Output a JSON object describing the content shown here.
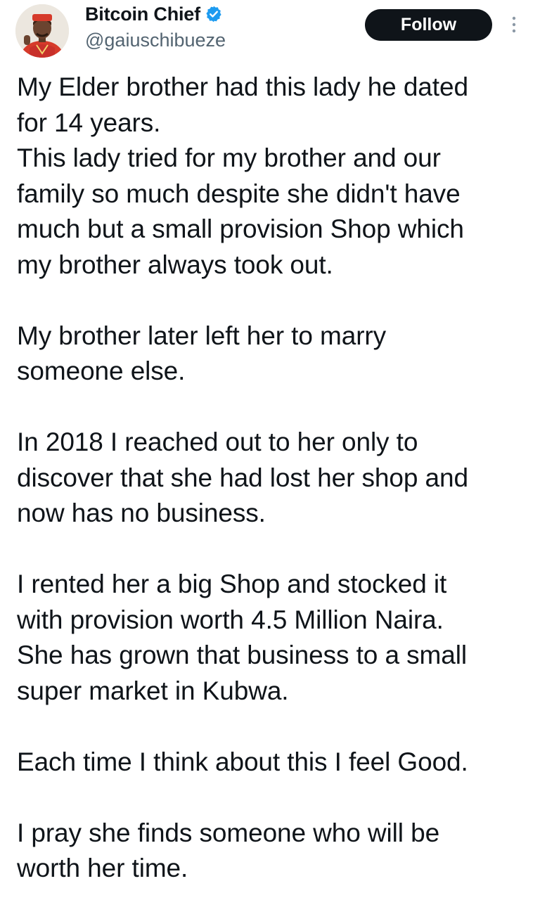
{
  "author": {
    "display_name": "Bitcoin Chief",
    "handle": "@gaiuschibueze",
    "verified": true,
    "avatar_icon": "profile-photo",
    "verified_color": "#1d9bf0"
  },
  "actions": {
    "follow_label": "Follow",
    "more_icon": "more-vertical-icon"
  },
  "tweet": {
    "paragraphs": [
      {
        "lines": [
          "My Elder brother had this lady he dated",
          "for 14 years.",
          "This lady tried for my brother and our",
          "family so much despite she didn't have",
          "much but a small provision Shop which",
          "my brother always took out."
        ]
      },
      {
        "lines": [
          "My brother later left her to marry",
          "someone else."
        ]
      },
      {
        "lines": [
          "In 2018 I reached out to her only to",
          "discover that she had lost her shop and",
          "now has no business."
        ]
      },
      {
        "lines": [
          "I rented her a big Shop and stocked it",
          "with provision worth 4.5 Million Naira.",
          "She has grown that business to a small",
          "super market in Kubwa."
        ]
      },
      {
        "lines": [
          "Each time I think about this I feel Good."
        ]
      },
      {
        "lines": [
          "I pray she finds someone who will be",
          "worth her time."
        ]
      }
    ]
  },
  "colors": {
    "text_primary": "#0f1419",
    "text_secondary": "#536471",
    "button_bg": "#0f1419",
    "button_text": "#ffffff"
  }
}
